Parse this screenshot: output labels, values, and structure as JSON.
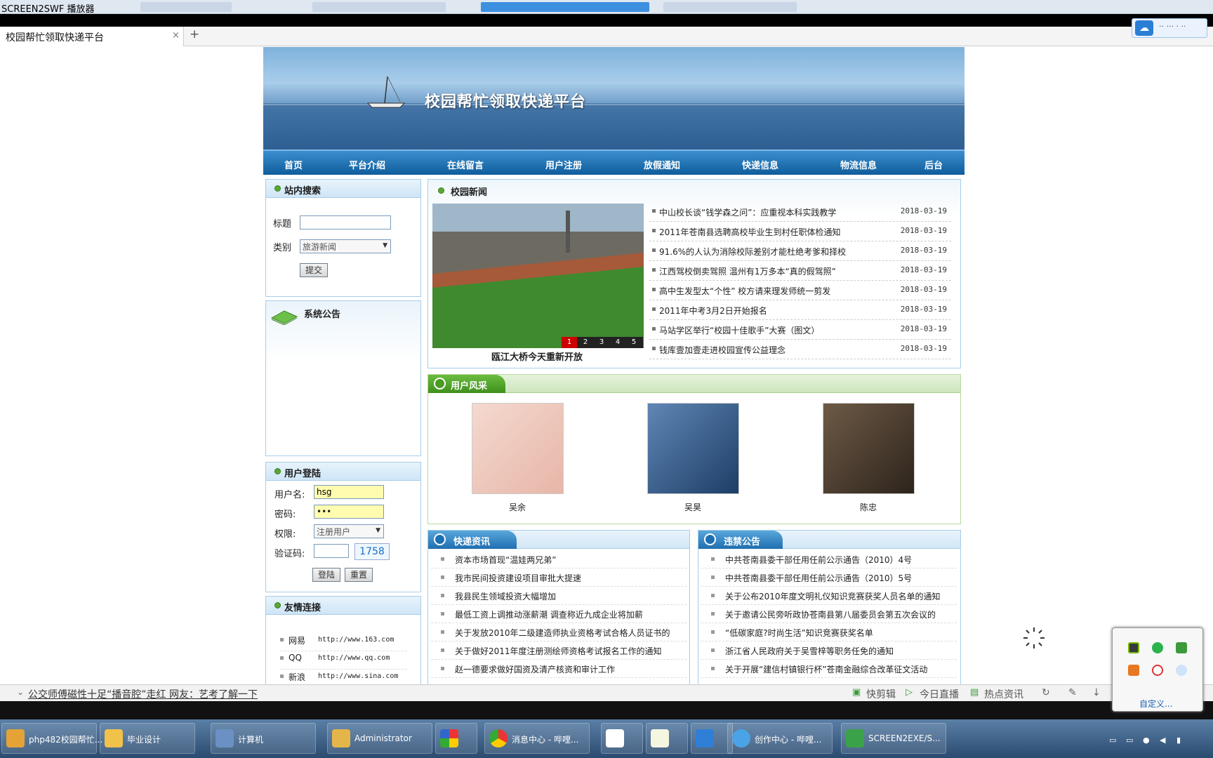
{
  "window": {
    "title": "SCREEN2SWF 播放器"
  },
  "browser": {
    "tab_title": "校园帮忙领取快递平台",
    "tab_close": "×",
    "new_tab": "+",
    "cloud_button": "·· ··· · ··"
  },
  "banner": {
    "title": "校园帮忙领取快递平台"
  },
  "nav": {
    "items": [
      "首页",
      "平台介绍",
      "在线留言",
      "用户注册",
      "放假通知",
      "快递信息",
      "物流信息",
      "后台"
    ]
  },
  "search": {
    "title": "站内搜索",
    "label_title": "标题",
    "label_category": "类别",
    "category_value": "旅游新闻",
    "submit": "提交"
  },
  "notice": {
    "title": "系统公告"
  },
  "login": {
    "title": "用户登陆",
    "label_user": "用户名:",
    "user_value": "hsg",
    "label_password": "密码:",
    "password_value": "•••",
    "label_role": "权限:",
    "role_value": "注册用户",
    "label_captcha": "验证码:",
    "captcha_code": "1758",
    "login_button": "登陆",
    "reset_button": "重置"
  },
  "links": {
    "title": "友情连接",
    "items": [
      {
        "name": "网易",
        "url": "http://www.163.com"
      },
      {
        "name": "QQ",
        "url": "http://www.qq.com"
      },
      {
        "name": "新浪",
        "url": "http://www.sina.com"
      }
    ]
  },
  "campus_news": {
    "title": "校园新闻",
    "image_caption": "瓯江大桥今天重新开放",
    "slide_pages": [
      "1",
      "2",
      "3",
      "4",
      "5"
    ],
    "items": [
      {
        "title": "中山校长谈“钱学森之问”：应重视本科实践教学",
        "date": "2018-03-19"
      },
      {
        "title": "2011年苍南县选聘高校毕业生到村任职体检通知",
        "date": "2018-03-19"
      },
      {
        "title": "91.6%的人认为消除校际差别才能杜绝考爹和择校",
        "date": "2018-03-19"
      },
      {
        "title": "江西驾校倒卖驾照 温州有1万多本“真的假驾照”",
        "date": "2018-03-19"
      },
      {
        "title": "高中生发型太“个性” 校方请来理发师统一剪发",
        "date": "2018-03-19"
      },
      {
        "title": "2011年中考3月2日开始报名",
        "date": "2018-03-19"
      },
      {
        "title": "马站学区举行“校园十佳歌手”大赛（图文）",
        "date": "2018-03-19"
      },
      {
        "title": "钱库壹加壹走进校园宣传公益理念",
        "date": "2018-03-19"
      }
    ]
  },
  "users": {
    "title": "用户风采",
    "items": [
      {
        "name": "吴余"
      },
      {
        "name": "吴昊"
      },
      {
        "name": "陈忠"
      }
    ]
  },
  "express": {
    "title": "快递资讯",
    "items": [
      "资本市场首现“温娃两兄弟”",
      "我市民间投资建设项目审批大提速",
      "我县民生领域投资大幅增加",
      "最低工资上调推动涨薪潮 调查称近九成企业将加薪",
      "关于发放2010年二级建造师执业资格考试合格人员证书的",
      "关于做好2011年度注册测绘师资格考试报名工作的通知",
      "赵一德要求做好国资及清产核资和审计工作"
    ]
  },
  "violation": {
    "title": "违禁公告",
    "items": [
      "中共苍南县委干部任用任前公示通告（2010）4号",
      "中共苍南县委干部任用任前公示通告（2010）5号",
      "关于公布2010年度文明礼仪知识竞赛获奖人员名单的通知",
      "关于邀请公民旁听政协苍南县第八届委员会第五次会议的",
      "“低碳家庭?时尚生活”知识竞赛获奖名单",
      "浙江省人民政府关于吴雪梓等职务任免的通知",
      "关于开展“建信村镇银行杯”苍南金融综合改革征文活动"
    ]
  },
  "statusbar": {
    "headline": "公交师傅磁性十足“播音腔”走红 网友：艺考了解一下",
    "quick_edit": "快剪辑",
    "live": "今日直播",
    "hot": "热点资讯"
  },
  "tray": {
    "customize": "自定义..."
  },
  "taskbar": {
    "items": [
      {
        "label": "php482校园帮忙..."
      },
      {
        "label": "毕业设计"
      },
      {
        "label": "计算机"
      },
      {
        "label": "Administrator"
      },
      {
        "label": ""
      },
      {
        "label": "消息中心 - 哔哩..."
      },
      {
        "label": ""
      },
      {
        "label": ""
      },
      {
        "label": ""
      },
      {
        "label": "创作中心 - 哔哩..."
      },
      {
        "label": "SCREEN2EXE/S..."
      }
    ]
  },
  "colors": {
    "nav": "#0f5d9c",
    "accent": "#3b8fcf",
    "highlight_input": "#fffcb0",
    "captcha": "#1a6fc4"
  }
}
